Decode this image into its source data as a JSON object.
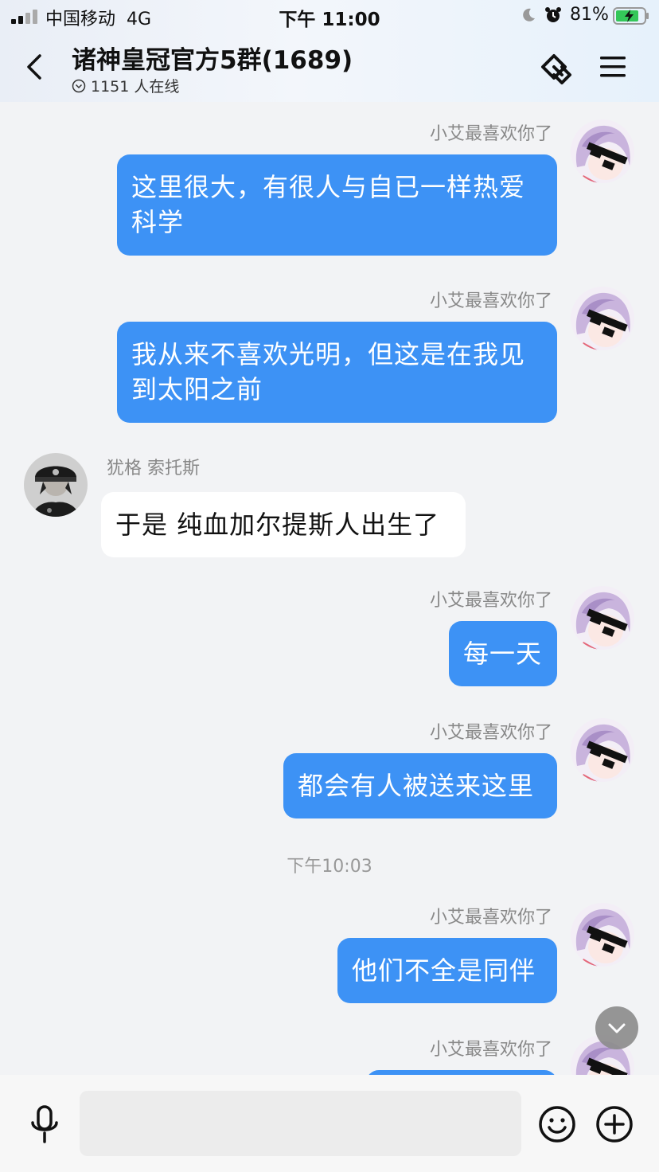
{
  "status_bar": {
    "carrier": "中国移动",
    "network": "4G",
    "time": "下午 11:00",
    "battery_percent": "81%"
  },
  "header": {
    "title": "诸神皇冠官方5群(1689)",
    "online": "1151 人在线"
  },
  "messages": [
    {
      "sender": "小艾最喜欢你了",
      "side": "right",
      "text": "这里很大，有很人与自已一样热爱科学"
    },
    {
      "sender": "小艾最喜欢你了",
      "side": "right",
      "text": "我从来不喜欢光明，但这是在我见到太阳之前"
    },
    {
      "sender": "犹格 索托斯",
      "side": "left",
      "text": "于是 纯血加尔提斯人出生了"
    },
    {
      "sender": "小艾最喜欢你了",
      "side": "right",
      "text": "每一天"
    },
    {
      "sender": "小艾最喜欢你了",
      "side": "right",
      "text": "都会有人被送来这里"
    },
    {
      "sender": "小艾最喜欢你了",
      "side": "right",
      "text": "他们不全是同伴"
    },
    {
      "sender": "小艾最喜欢你了",
      "side": "right",
      "text": ""
    }
  ],
  "timestamp": "下午10:03",
  "input": {
    "value": "",
    "placeholder": ""
  },
  "colors": {
    "bubble_out": "#3d92f5",
    "bubble_in": "#ffffff",
    "background": "#f2f3f5"
  },
  "icons": [
    "back-icon",
    "share-icon",
    "menu-icon",
    "mic-icon",
    "emoji-icon",
    "plus-icon",
    "chevron-down-icon"
  ]
}
